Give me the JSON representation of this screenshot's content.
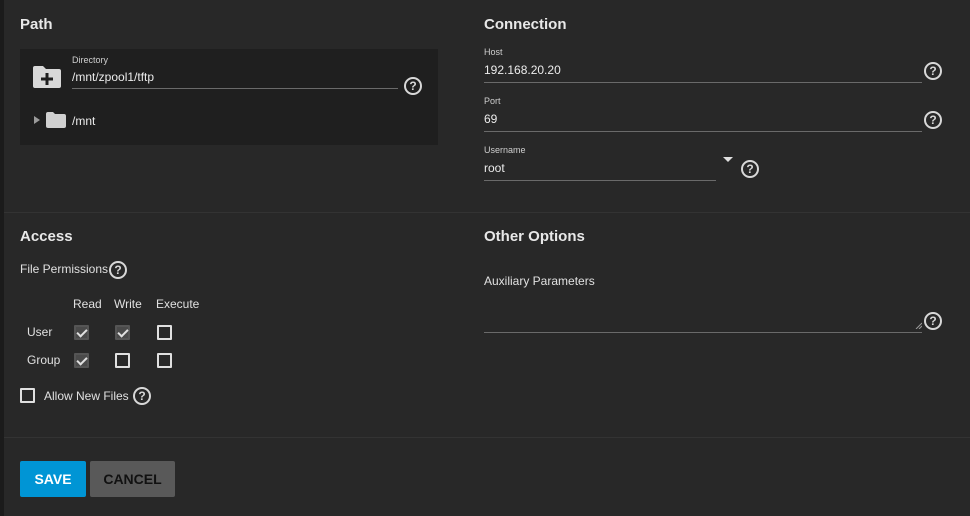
{
  "path": {
    "title": "Path",
    "directory_label": "Directory",
    "directory_value": "/mnt/zpool1/tftp",
    "tree_item": "/mnt"
  },
  "connection": {
    "title": "Connection",
    "host_label": "Host",
    "host_value": "192.168.20.20",
    "port_label": "Port",
    "port_value": "69",
    "username_label": "Username",
    "username_value": "root"
  },
  "access": {
    "title": "Access",
    "file_permissions_label": "File Permissions",
    "columns": [
      "Read",
      "Write",
      "Execute"
    ],
    "rows": [
      {
        "label": "User",
        "read": true,
        "write": true,
        "execute": false
      },
      {
        "label": "Group",
        "read": true,
        "write": false,
        "execute": false
      }
    ],
    "allow_new_files_label": "Allow New Files",
    "allow_new_files": false
  },
  "other": {
    "title": "Other Options",
    "aux_label": "Auxiliary Parameters",
    "aux_value": ""
  },
  "buttons": {
    "save": "SAVE",
    "cancel": "CANCEL"
  },
  "help_glyph": "?",
  "colors": {
    "background": "#282828",
    "primary": "#0095d5",
    "cancel": "#595959"
  }
}
